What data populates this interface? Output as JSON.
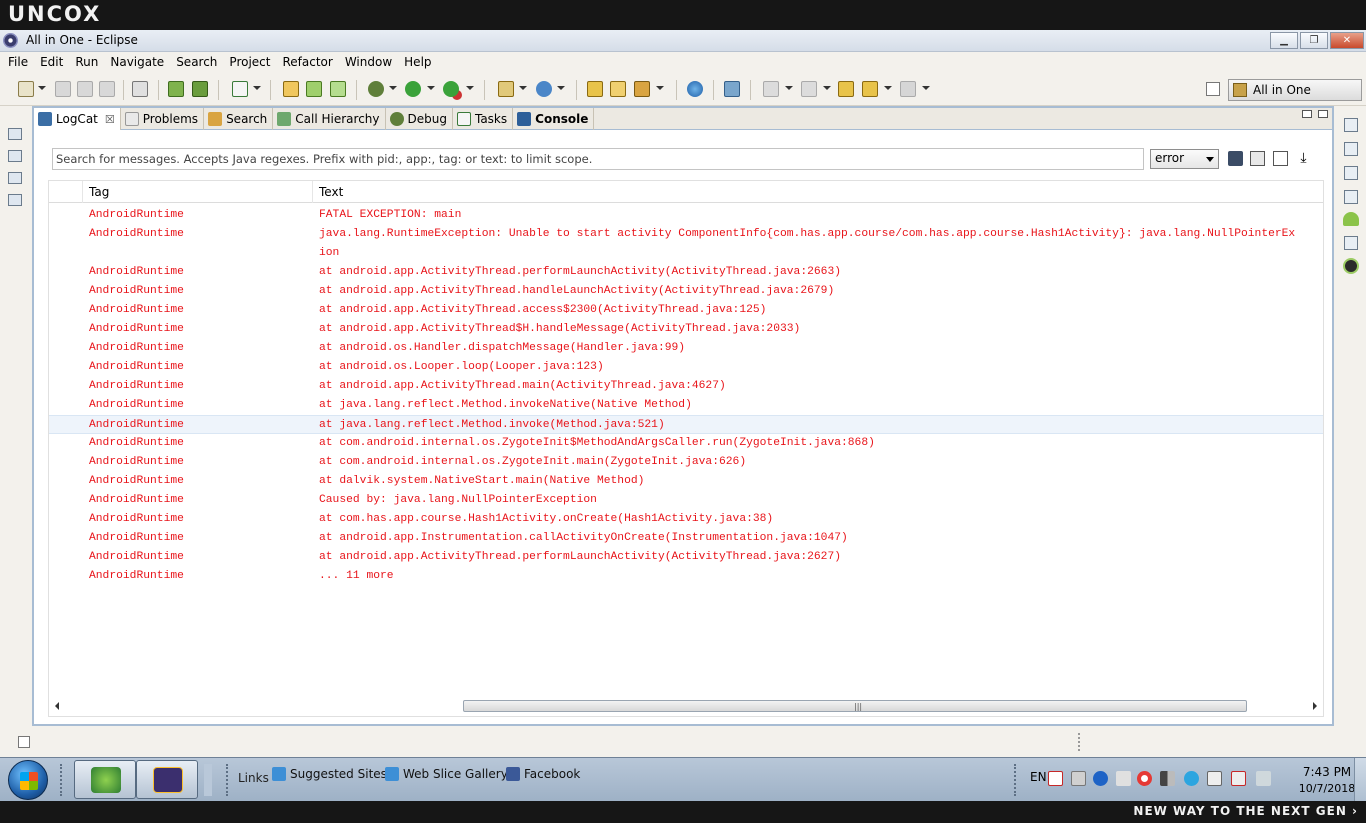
{
  "brand": {
    "logo": "UNCOX",
    "slogan": "NEW WAY TO THE NEXT GEN ›"
  },
  "window": {
    "title": "All in One - Eclipse"
  },
  "menu": [
    "File",
    "Edit",
    "Run",
    "Navigate",
    "Search",
    "Project",
    "Refactor",
    "Window",
    "Help"
  ],
  "perspective": {
    "label": "All in One"
  },
  "tabs": [
    {
      "label": "LogCat",
      "icon": "logcat-icon",
      "active": true,
      "closable": true
    },
    {
      "label": "Problems",
      "icon": "problems-icon"
    },
    {
      "label": "Search",
      "icon": "search-icon"
    },
    {
      "label": "Call Hierarchy",
      "icon": "call-hierarchy-icon"
    },
    {
      "label": "Debug",
      "icon": "debug-icon"
    },
    {
      "label": "Tasks",
      "icon": "tasks-icon"
    },
    {
      "label": "Console",
      "icon": "console-icon"
    }
  ],
  "logcat": {
    "search_placeholder": "Search for messages. Accepts Java regexes. Prefix with pid:, app:, tag: or text: to limit scope.",
    "level": "error",
    "columns": {
      "tag": "Tag",
      "text": "Text"
    },
    "log_color": "#e8141a",
    "rows": [
      {
        "tag": "AndroidRuntime",
        "text": "FATAL EXCEPTION: main"
      },
      {
        "tag": "AndroidRuntime",
        "text": "java.lang.RuntimeException: Unable to start activity ComponentInfo{com.has.app.course/com.has.app.course.Hash1Activity}: java.lang.NullPointerEx"
      },
      {
        "tag": "",
        "text": "ion"
      },
      {
        "tag": "AndroidRuntime",
        "text": "at android.app.ActivityThread.performLaunchActivity(ActivityThread.java:2663)"
      },
      {
        "tag": "AndroidRuntime",
        "text": "at android.app.ActivityThread.handleLaunchActivity(ActivityThread.java:2679)"
      },
      {
        "tag": "AndroidRuntime",
        "text": "at android.app.ActivityThread.access$2300(ActivityThread.java:125)"
      },
      {
        "tag": "AndroidRuntime",
        "text": "at android.app.ActivityThread$H.handleMessage(ActivityThread.java:2033)"
      },
      {
        "tag": "AndroidRuntime",
        "text": "at android.os.Handler.dispatchMessage(Handler.java:99)"
      },
      {
        "tag": "AndroidRuntime",
        "text": "at android.os.Looper.loop(Looper.java:123)"
      },
      {
        "tag": "AndroidRuntime",
        "text": "at android.app.ActivityThread.main(ActivityThread.java:4627)"
      },
      {
        "tag": "AndroidRuntime",
        "text": "at java.lang.reflect.Method.invokeNative(Native Method)"
      },
      {
        "tag": "AndroidRuntime",
        "text": "at java.lang.reflect.Method.invoke(Method.java:521)",
        "selected": true
      },
      {
        "tag": "AndroidRuntime",
        "text": "at com.android.internal.os.ZygoteInit$MethodAndArgsCaller.run(ZygoteInit.java:868)"
      },
      {
        "tag": "AndroidRuntime",
        "text": "at com.android.internal.os.ZygoteInit.main(ZygoteInit.java:626)"
      },
      {
        "tag": "AndroidRuntime",
        "text": "at dalvik.system.NativeStart.main(Native Method)"
      },
      {
        "tag": "AndroidRuntime",
        "text": "Caused by: java.lang.NullPointerException"
      },
      {
        "tag": "AndroidRuntime",
        "text": "at com.has.app.course.Hash1Activity.onCreate(Hash1Activity.java:38)"
      },
      {
        "tag": "AndroidRuntime",
        "text": "at android.app.Instrumentation.callActivityOnCreate(Instrumentation.java:1047)"
      },
      {
        "tag": "AndroidRuntime",
        "text": "at android.app.ActivityThread.performLaunchActivity(ActivityThread.java:2627)"
      },
      {
        "tag": "AndroidRuntime",
        "text": "... 11 more"
      }
    ]
  },
  "taskbar": {
    "links_label": "Links",
    "links": [
      {
        "label": "Suggested Sites",
        "icon": "ie-icon"
      },
      {
        "label": "Web Slice Gallery",
        "icon": "ie-icon"
      },
      {
        "label": "Facebook",
        "icon": "facebook-icon"
      }
    ],
    "tray": {
      "lang": "EN",
      "time": "7:43 PM",
      "date": "10/7/2018"
    }
  }
}
